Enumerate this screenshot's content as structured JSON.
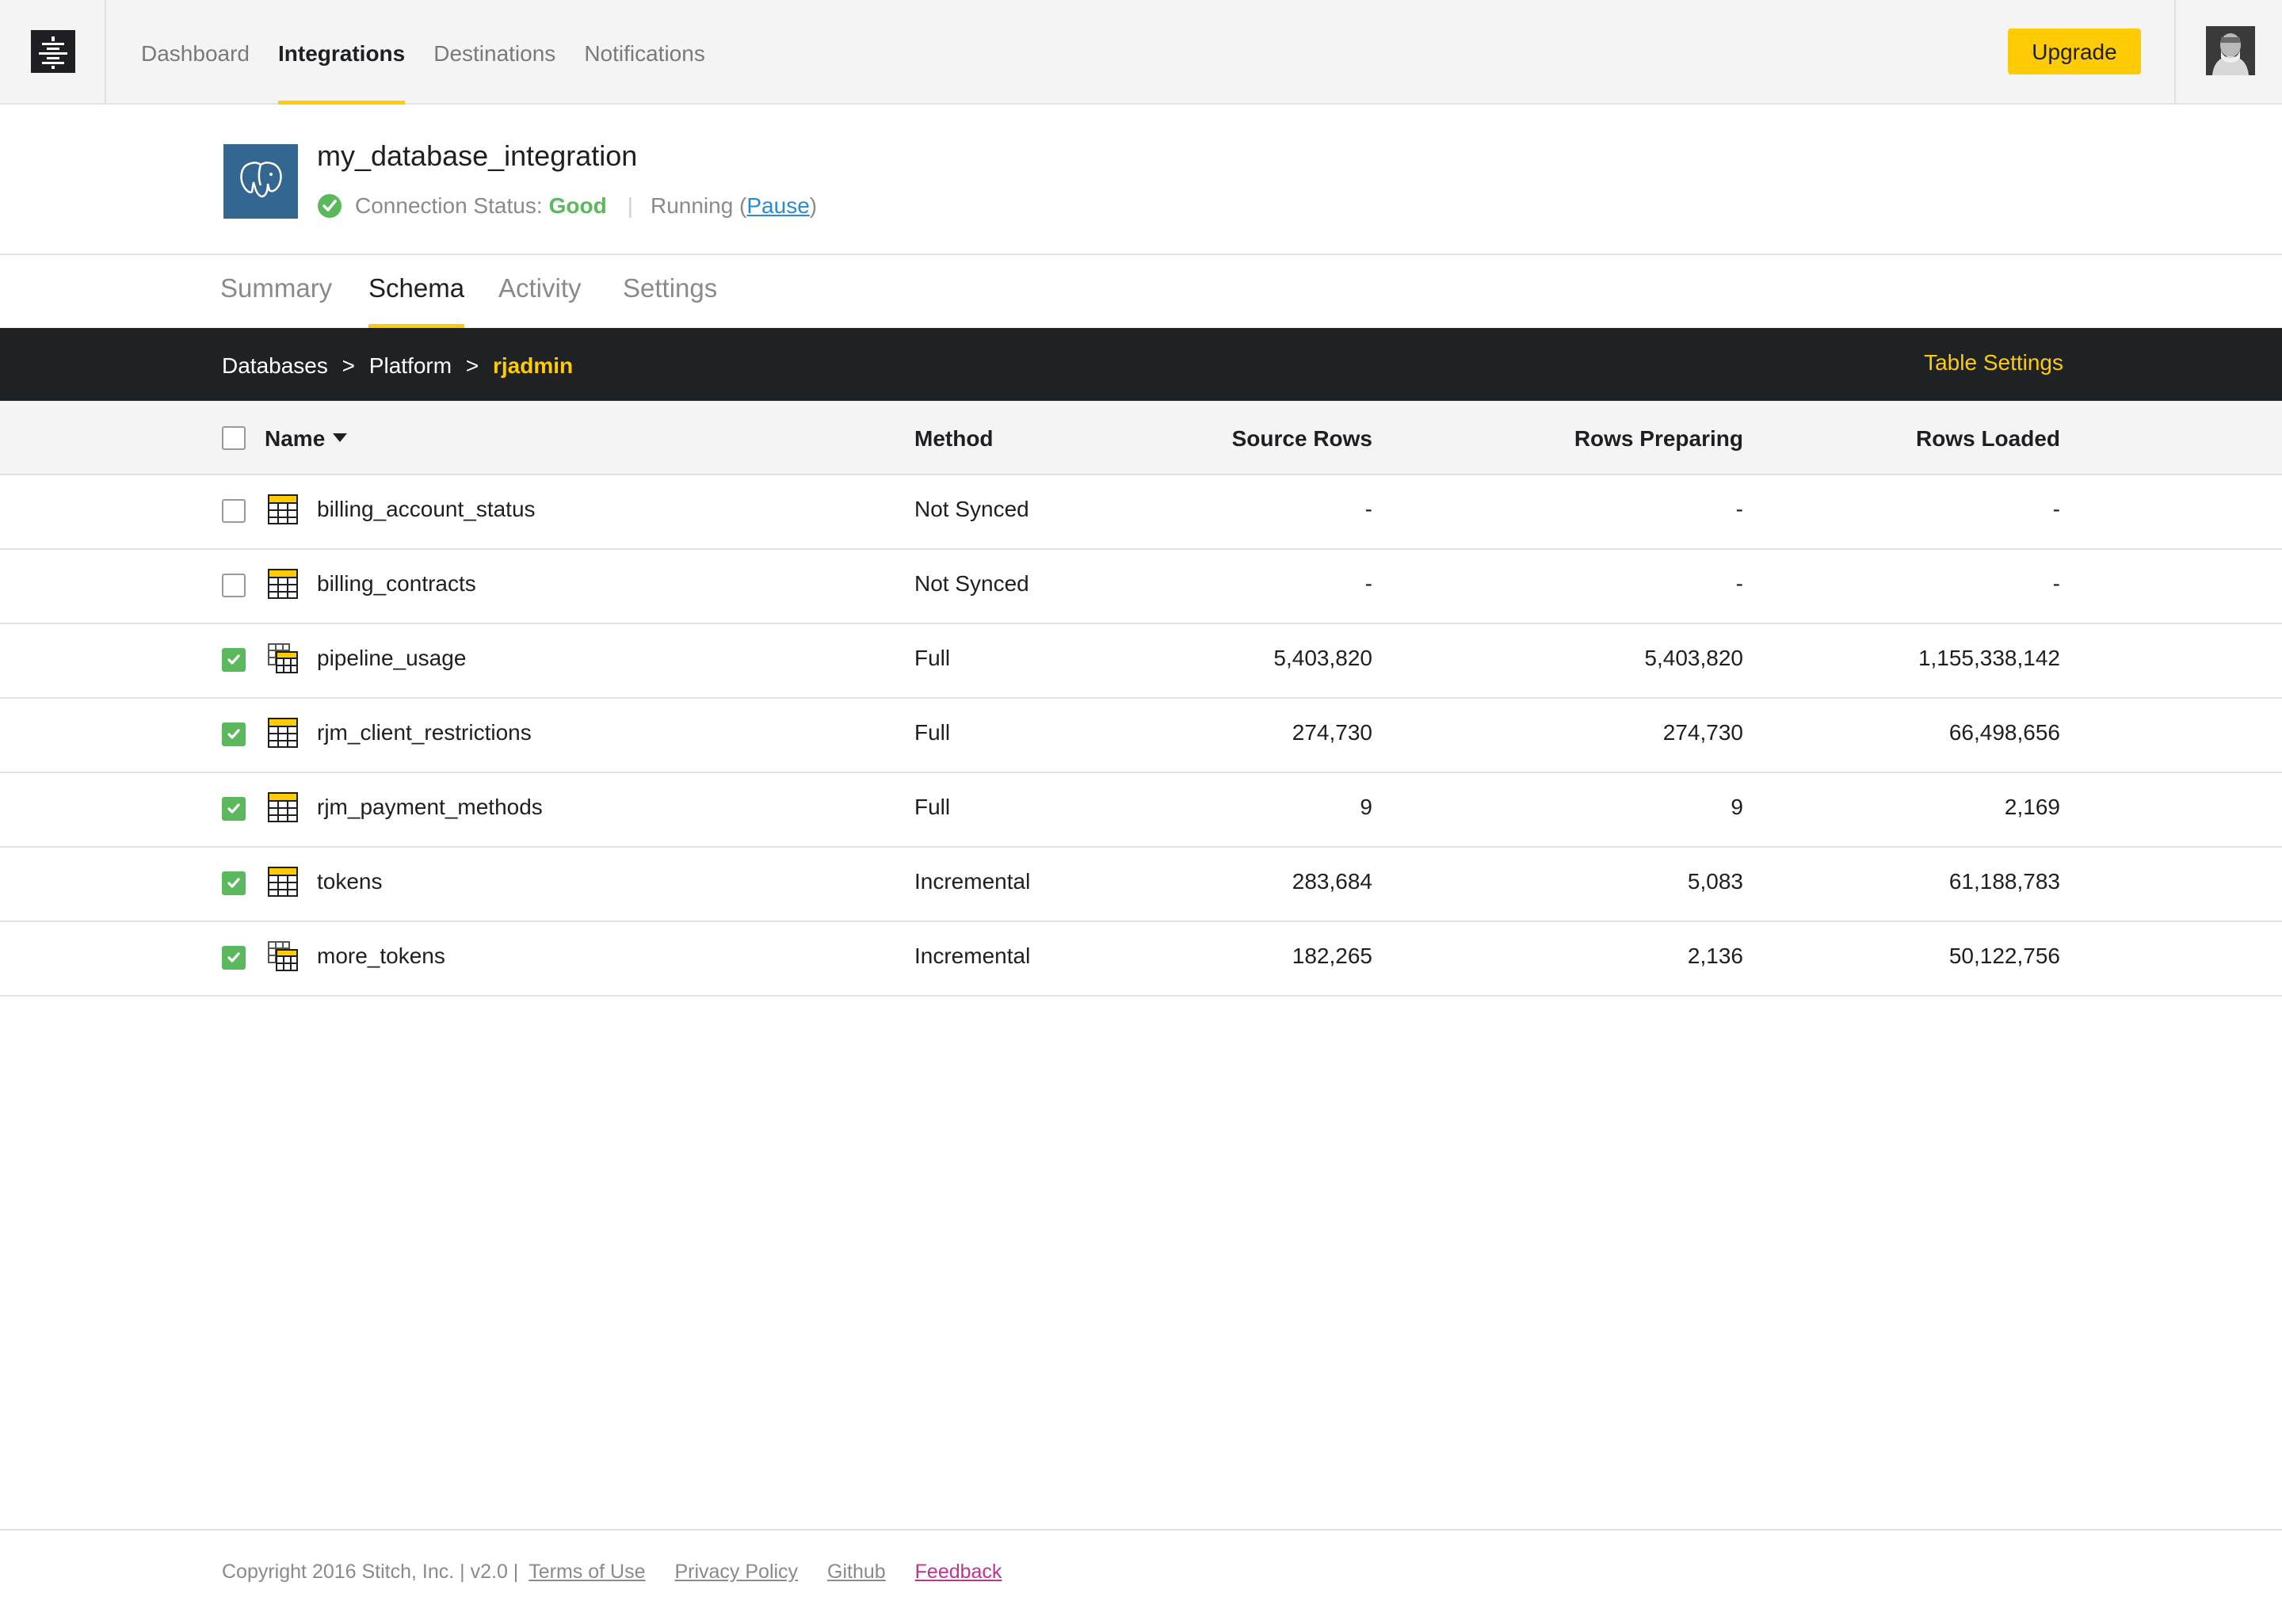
{
  "nav": {
    "items": [
      "Dashboard",
      "Integrations",
      "Destinations",
      "Notifications"
    ],
    "active": "Integrations",
    "upgrade_label": "Upgrade"
  },
  "integration": {
    "name": "my_database_integration",
    "status_prefix": "Connection Status:",
    "status_value": "Good",
    "running_text": "Running (",
    "pause_label": "Pause",
    "running_suffix": ")"
  },
  "tabs": [
    "Summary",
    "Schema",
    "Activity",
    "Settings"
  ],
  "active_tab": "Schema",
  "breadcrumb": {
    "items": [
      "Databases",
      "Platform"
    ],
    "separator": ">",
    "current": "rjadmin"
  },
  "table_settings_label": "Table Settings",
  "table": {
    "columns": [
      "Name",
      "Method",
      "Source Rows",
      "Rows Preparing",
      "Rows Loaded"
    ],
    "rows": [
      {
        "name": "billing_account_status",
        "method": "Not Synced",
        "source": "-",
        "preparing": "-",
        "loaded": "-",
        "selected": false,
        "icon": "table-icon"
      },
      {
        "name": "billing_contracts",
        "method": "Not Synced",
        "source": "-",
        "preparing": "-",
        "loaded": "-",
        "selected": false,
        "icon": "table-icon"
      },
      {
        "name": "pipeline_usage",
        "method": "Full",
        "source": "5,403,820",
        "preparing": "5,403,820",
        "loaded": "1,155,338,142",
        "selected": true,
        "icon": "table-view-icon"
      },
      {
        "name": "rjm_client_restrictions",
        "method": "Full",
        "source": "274,730",
        "preparing": "274,730",
        "loaded": "66,498,656",
        "selected": true,
        "icon": "table-icon"
      },
      {
        "name": "rjm_payment_methods",
        "method": "Full",
        "source": "9",
        "preparing": "9",
        "loaded": "2,169",
        "selected": true,
        "icon": "table-icon"
      },
      {
        "name": "tokens",
        "method": "Incremental",
        "source": "283,684",
        "preparing": "5,083",
        "loaded": "61,188,783",
        "selected": true,
        "icon": "table-icon"
      },
      {
        "name": "more_tokens",
        "method": "Incremental",
        "source": "182,265",
        "preparing": "2,136",
        "loaded": "50,122,756",
        "selected": true,
        "icon": "table-view-icon"
      }
    ]
  },
  "footer": {
    "copyright": "Copyright 2016 Stitch, Inc. | v2.0 |",
    "links": [
      "Terms of Use",
      "Privacy Policy",
      "Github",
      "Feedback"
    ]
  },
  "colors": {
    "accent": "#ffcb05",
    "dark": "#1f2225",
    "success": "#5cb85c",
    "link": "#2a8ccc",
    "feedback": "#c0338f",
    "postgres": "#336791"
  }
}
